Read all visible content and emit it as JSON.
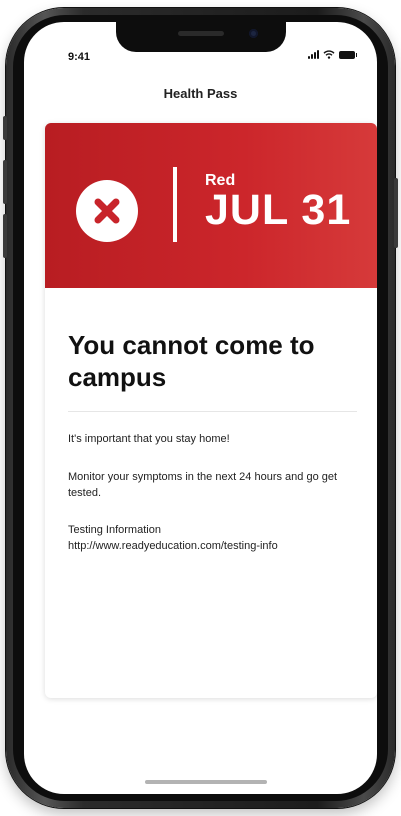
{
  "status_bar": {
    "time": "9:41",
    "icons": [
      "signal-icon",
      "wifi-icon",
      "battery-icon"
    ]
  },
  "nav": {
    "title": "Health Pass"
  },
  "pass": {
    "status_label": "Red",
    "date": "JUL 31",
    "status_icon": "close-circle-icon",
    "colors": {
      "banner": "#c8242a",
      "badge": "#ffffff"
    }
  },
  "content": {
    "headline": "You cannot come to campus",
    "message": "It's important that you stay home!",
    "instructions": "Monitor your symptoms in the next 24 hours and go get tested.",
    "testing_label": "Testing Information",
    "testing_link": "http://www.readyeducation.com/testing-info"
  }
}
